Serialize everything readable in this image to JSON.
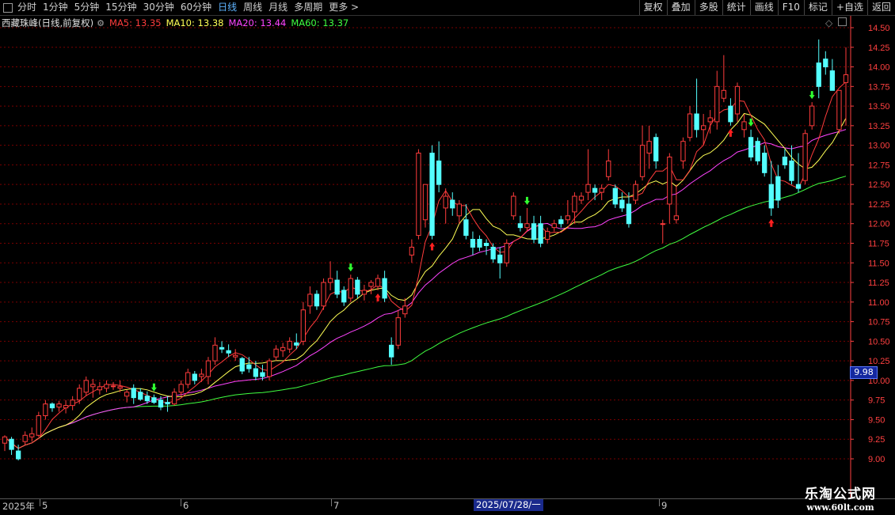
{
  "toolbar": {
    "periods": [
      "分时",
      "1分钟",
      "5分钟",
      "15分钟",
      "30分钟",
      "60分钟",
      "日线",
      "周线",
      "月线",
      "多周期",
      "更多 >"
    ],
    "active_period": "日线",
    "right_buttons": [
      "复权",
      "叠加",
      "多股",
      "统计",
      "画线",
      "F10",
      "标记",
      "+自选",
      "返回"
    ]
  },
  "header": {
    "title": "西藏珠峰(日线,前复权)",
    "ma5": "MA5: 13.35",
    "ma10": "MA10: 13.38",
    "ma20": "MA20: 13.44",
    "ma60": "MA60: 13.37"
  },
  "colors": {
    "up": "#ff3c3c",
    "down": "#54ffff",
    "ma5": "#ff3c3c",
    "ma10": "#ffff55",
    "ma20": "#ff44ff",
    "ma60": "#40ff40",
    "grid": "#7a0000",
    "axis_text": "#ff4040"
  },
  "price_axis": {
    "labels": [
      "14.50",
      "14.25",
      "14.00",
      "13.75",
      "13.50",
      "13.25",
      "13.00",
      "12.75",
      "12.50",
      "12.25",
      "12.00",
      "11.75",
      "11.50",
      "11.25",
      "11.00",
      "10.75",
      "10.50",
      "10.25",
      "10.00",
      "9.75",
      "9.50",
      "9.25",
      "9.00"
    ],
    "cursor_value": "9.98"
  },
  "date_axis": {
    "labels": [
      "2025年",
      "5",
      "6",
      "7",
      "2025/07/28/一",
      "9"
    ]
  },
  "watermark": {
    "line1": "乐淘公式网",
    "line2": "www.60lt.com"
  },
  "chart_data": {
    "type": "candlestick",
    "ylim": [
      8.85,
      14.6
    ],
    "candles": [
      {
        "o": 9.2,
        "h": 9.3,
        "l": 9.1,
        "c": 9.28
      },
      {
        "o": 9.25,
        "h": 9.28,
        "l": 9.05,
        "c": 9.12
      },
      {
        "o": 9.1,
        "h": 9.18,
        "l": 8.98,
        "c": 9.0
      },
      {
        "o": 9.22,
        "h": 9.35,
        "l": 9.18,
        "c": 9.3
      },
      {
        "o": 9.28,
        "h": 9.4,
        "l": 9.22,
        "c": 9.32
      },
      {
        "o": 9.3,
        "h": 9.6,
        "l": 9.28,
        "c": 9.55
      },
      {
        "o": 9.55,
        "h": 9.75,
        "l": 9.5,
        "c": 9.7
      },
      {
        "o": 9.7,
        "h": 9.72,
        "l": 9.6,
        "c": 9.65
      },
      {
        "o": 9.66,
        "h": 9.74,
        "l": 9.6,
        "c": 9.7
      },
      {
        "o": 9.65,
        "h": 9.75,
        "l": 9.58,
        "c": 9.68
      },
      {
        "o": 9.68,
        "h": 9.8,
        "l": 9.62,
        "c": 9.75
      },
      {
        "o": 9.75,
        "h": 9.95,
        "l": 9.7,
        "c": 9.9
      },
      {
        "o": 9.85,
        "h": 10.05,
        "l": 9.8,
        "c": 10.0
      },
      {
        "o": 9.92,
        "h": 10.02,
        "l": 9.78,
        "c": 9.95
      },
      {
        "o": 9.88,
        "h": 9.98,
        "l": 9.82,
        "c": 9.92
      },
      {
        "o": 9.9,
        "h": 10.0,
        "l": 9.85,
        "c": 9.95
      },
      {
        "o": 9.92,
        "h": 9.98,
        "l": 9.88,
        "c": 9.93
      },
      {
        "o": 9.9,
        "h": 10.0,
        "l": 9.85,
        "c": 9.92
      },
      {
        "o": 9.8,
        "h": 9.88,
        "l": 9.72,
        "c": 9.85
      },
      {
        "o": 9.9,
        "h": 9.95,
        "l": 9.7,
        "c": 9.78
      },
      {
        "o": 9.85,
        "h": 9.9,
        "l": 9.74,
        "c": 9.76
      },
      {
        "o": 9.8,
        "h": 9.86,
        "l": 9.7,
        "c": 9.74
      },
      {
        "o": 9.78,
        "h": 9.82,
        "l": 9.7,
        "c": 9.72
      },
      {
        "o": 9.75,
        "h": 9.8,
        "l": 9.62,
        "c": 9.66
      },
      {
        "o": 9.72,
        "h": 9.8,
        "l": 9.6,
        "c": 9.7
      },
      {
        "o": 9.7,
        "h": 9.9,
        "l": 9.68,
        "c": 9.85
      },
      {
        "o": 9.85,
        "h": 10.0,
        "l": 9.8,
        "c": 9.95
      },
      {
        "o": 9.95,
        "h": 10.15,
        "l": 9.9,
        "c": 10.1
      },
      {
        "o": 10.08,
        "h": 10.12,
        "l": 9.95,
        "c": 10.0
      },
      {
        "o": 10.05,
        "h": 10.15,
        "l": 9.98,
        "c": 10.08
      },
      {
        "o": 10.05,
        "h": 10.3,
        "l": 9.95,
        "c": 10.25
      },
      {
        "o": 10.25,
        "h": 10.55,
        "l": 10.2,
        "c": 10.45
      },
      {
        "o": 10.42,
        "h": 10.5,
        "l": 10.35,
        "c": 10.4
      },
      {
        "o": 10.38,
        "h": 10.46,
        "l": 10.3,
        "c": 10.35
      },
      {
        "o": 10.3,
        "h": 10.4,
        "l": 10.25,
        "c": 10.32
      },
      {
        "o": 10.28,
        "h": 10.3,
        "l": 10.08,
        "c": 10.12
      },
      {
        "o": 10.2,
        "h": 10.3,
        "l": 10.1,
        "c": 10.15
      },
      {
        "o": 10.15,
        "h": 10.25,
        "l": 10.0,
        "c": 10.05
      },
      {
        "o": 10.1,
        "h": 10.2,
        "l": 10.0,
        "c": 10.05
      },
      {
        "o": 10.05,
        "h": 10.28,
        "l": 10.0,
        "c": 10.25
      },
      {
        "o": 10.3,
        "h": 10.45,
        "l": 10.25,
        "c": 10.4
      },
      {
        "o": 10.38,
        "h": 10.48,
        "l": 10.3,
        "c": 10.42
      },
      {
        "o": 10.4,
        "h": 10.55,
        "l": 10.35,
        "c": 10.5
      },
      {
        "o": 10.48,
        "h": 10.6,
        "l": 10.4,
        "c": 10.45
      },
      {
        "o": 10.5,
        "h": 11.0,
        "l": 10.45,
        "c": 10.9
      },
      {
        "o": 10.95,
        "h": 11.2,
        "l": 10.85,
        "c": 11.1
      },
      {
        "o": 11.1,
        "h": 11.15,
        "l": 10.9,
        "c": 10.95
      },
      {
        "o": 10.95,
        "h": 11.3,
        "l": 10.9,
        "c": 11.25
      },
      {
        "o": 11.25,
        "h": 11.52,
        "l": 11.15,
        "c": 11.3
      },
      {
        "o": 11.28,
        "h": 11.4,
        "l": 11.05,
        "c": 11.1
      },
      {
        "o": 11.15,
        "h": 11.2,
        "l": 10.95,
        "c": 11.0
      },
      {
        "o": 11.05,
        "h": 11.35,
        "l": 11.0,
        "c": 11.3
      },
      {
        "o": 11.28,
        "h": 11.32,
        "l": 11.05,
        "c": 11.1
      },
      {
        "o": 11.1,
        "h": 11.22,
        "l": 11.02,
        "c": 11.15
      },
      {
        "o": 11.2,
        "h": 11.28,
        "l": 11.1,
        "c": 11.25
      },
      {
        "o": 11.2,
        "h": 11.35,
        "l": 11.15,
        "c": 11.3
      },
      {
        "o": 11.3,
        "h": 11.4,
        "l": 11.0,
        "c": 11.05
      },
      {
        "o": 10.45,
        "h": 10.55,
        "l": 10.2,
        "c": 10.3
      },
      {
        "o": 10.45,
        "h": 10.9,
        "l": 10.4,
        "c": 10.8
      },
      {
        "o": 10.85,
        "h": 11.05,
        "l": 10.8,
        "c": 10.95
      },
      {
        "o": 11.6,
        "h": 11.8,
        "l": 11.5,
        "c": 11.7
      },
      {
        "o": 11.85,
        "h": 12.95,
        "l": 11.8,
        "c": 12.9
      },
      {
        "o": 12.05,
        "h": 12.5,
        "l": 11.95,
        "c": 12.5
      },
      {
        "o": 12.9,
        "h": 13.0,
        "l": 11.8,
        "c": 11.85
      },
      {
        "o": 12.8,
        "h": 13.05,
        "l": 12.4,
        "c": 12.5
      },
      {
        "o": 12.2,
        "h": 12.45,
        "l": 12.0,
        "c": 12.35
      },
      {
        "o": 12.3,
        "h": 12.4,
        "l": 12.1,
        "c": 12.2
      },
      {
        "o": 12.1,
        "h": 12.3,
        "l": 12.0,
        "c": 12.25
      },
      {
        "o": 12.05,
        "h": 12.25,
        "l": 11.8,
        "c": 11.85
      },
      {
        "o": 11.8,
        "h": 11.9,
        "l": 11.6,
        "c": 11.7
      },
      {
        "o": 11.8,
        "h": 11.85,
        "l": 11.65,
        "c": 11.7
      },
      {
        "o": 11.75,
        "h": 11.8,
        "l": 11.6,
        "c": 11.72
      },
      {
        "o": 11.7,
        "h": 11.75,
        "l": 11.5,
        "c": 11.55
      },
      {
        "o": 11.6,
        "h": 11.7,
        "l": 11.3,
        "c": 11.5
      },
      {
        "o": 11.5,
        "h": 11.8,
        "l": 11.45,
        "c": 11.75
      },
      {
        "o": 12.1,
        "h": 12.4,
        "l": 12.05,
        "c": 12.35
      },
      {
        "o": 12.0,
        "h": 12.1,
        "l": 11.9,
        "c": 11.95
      },
      {
        "o": 11.95,
        "h": 12.2,
        "l": 11.9,
        "c": 12.0
      },
      {
        "o": 12.0,
        "h": 12.1,
        "l": 11.75,
        "c": 11.8
      },
      {
        "o": 12.0,
        "h": 12.1,
        "l": 11.7,
        "c": 11.75
      },
      {
        "o": 11.8,
        "h": 11.95,
        "l": 11.75,
        "c": 11.9
      },
      {
        "o": 11.95,
        "h": 12.05,
        "l": 11.9,
        "c": 12.0
      },
      {
        "o": 12.05,
        "h": 12.1,
        "l": 11.95,
        "c": 12.0
      },
      {
        "o": 12.05,
        "h": 12.3,
        "l": 12.0,
        "c": 12.1
      },
      {
        "o": 12.15,
        "h": 12.4,
        "l": 12.0,
        "c": 12.35
      },
      {
        "o": 12.3,
        "h": 12.4,
        "l": 12.25,
        "c": 12.35
      },
      {
        "o": 12.4,
        "h": 12.95,
        "l": 12.3,
        "c": 12.5
      },
      {
        "o": 12.45,
        "h": 12.5,
        "l": 12.3,
        "c": 12.4
      },
      {
        "o": 12.4,
        "h": 12.5,
        "l": 12.3,
        "c": 12.45
      },
      {
        "o": 12.6,
        "h": 12.95,
        "l": 12.55,
        "c": 12.8
      },
      {
        "o": 12.45,
        "h": 12.5,
        "l": 12.2,
        "c": 12.25
      },
      {
        "o": 12.3,
        "h": 12.4,
        "l": 12.15,
        "c": 12.2
      },
      {
        "o": 12.25,
        "h": 12.4,
        "l": 11.95,
        "c": 12.0
      },
      {
        "o": 12.3,
        "h": 12.55,
        "l": 12.25,
        "c": 12.5
      },
      {
        "o": 12.6,
        "h": 13.25,
        "l": 12.55,
        "c": 13.0
      },
      {
        "o": 12.9,
        "h": 13.25,
        "l": 12.7,
        "c": 13.05
      },
      {
        "o": 13.1,
        "h": 13.15,
        "l": 12.7,
        "c": 12.8
      },
      {
        "o": 12.0,
        "h": 12.05,
        "l": 11.75,
        "c": 12.0
      },
      {
        "o": 12.25,
        "h": 12.9,
        "l": 12.0,
        "c": 12.85
      },
      {
        "o": 12.05,
        "h": 12.5,
        "l": 12.0,
        "c": 12.1
      },
      {
        "o": 12.8,
        "h": 13.1,
        "l": 12.7,
        "c": 13.05
      },
      {
        "o": 13.1,
        "h": 13.5,
        "l": 13.05,
        "c": 13.4
      },
      {
        "o": 13.4,
        "h": 13.85,
        "l": 13.1,
        "c": 13.2
      },
      {
        "o": 13.2,
        "h": 13.4,
        "l": 13.0,
        "c": 13.25
      },
      {
        "o": 13.3,
        "h": 13.45,
        "l": 13.15,
        "c": 13.35
      },
      {
        "o": 13.3,
        "h": 13.95,
        "l": 13.2,
        "c": 13.75
      },
      {
        "o": 13.6,
        "h": 14.15,
        "l": 13.55,
        "c": 13.7
      },
      {
        "o": 13.5,
        "h": 13.6,
        "l": 13.25,
        "c": 13.3
      },
      {
        "o": 13.4,
        "h": 13.8,
        "l": 13.3,
        "c": 13.75
      },
      {
        "o": 13.2,
        "h": 13.4,
        "l": 13.1,
        "c": 13.3
      },
      {
        "o": 13.1,
        "h": 13.2,
        "l": 12.8,
        "c": 12.85
      },
      {
        "o": 13.05,
        "h": 13.1,
        "l": 12.75,
        "c": 12.8
      },
      {
        "o": 12.9,
        "h": 13.0,
        "l": 12.6,
        "c": 12.65
      },
      {
        "o": 12.5,
        "h": 12.8,
        "l": 12.1,
        "c": 12.2
      },
      {
        "o": 12.6,
        "h": 12.75,
        "l": 12.2,
        "c": 12.3
      },
      {
        "o": 12.85,
        "h": 12.95,
        "l": 12.7,
        "c": 12.75
      },
      {
        "o": 12.8,
        "h": 13.0,
        "l": 12.5,
        "c": 12.55
      },
      {
        "o": 12.5,
        "h": 12.9,
        "l": 12.4,
        "c": 12.45
      },
      {
        "o": 12.55,
        "h": 13.2,
        "l": 12.5,
        "c": 13.15
      },
      {
        "o": 13.25,
        "h": 13.55,
        "l": 13.2,
        "c": 13.5
      },
      {
        "o": 14.05,
        "h": 14.35,
        "l": 13.6,
        "c": 13.75
      },
      {
        "o": 14.1,
        "h": 14.2,
        "l": 13.9,
        "c": 14.0
      },
      {
        "o": 13.95,
        "h": 14.1,
        "l": 13.7,
        "c": 13.7
      },
      {
        "o": 13.2,
        "h": 13.7,
        "l": 13.15,
        "c": 13.7
      },
      {
        "o": 13.8,
        "h": 14.25,
        "l": 13.25,
        "c": 13.9
      }
    ],
    "markers": [
      {
        "i": 22,
        "type": "down"
      },
      {
        "i": 51,
        "type": "down"
      },
      {
        "i": 55,
        "type": "up"
      },
      {
        "i": 63,
        "type": "up"
      },
      {
        "i": 77,
        "type": "down"
      },
      {
        "i": 107,
        "type": "up"
      },
      {
        "i": 110,
        "type": "down"
      },
      {
        "i": 113,
        "type": "up"
      },
      {
        "i": 119,
        "type": "down"
      },
      {
        "i": 136,
        "type": "up"
      }
    ]
  }
}
